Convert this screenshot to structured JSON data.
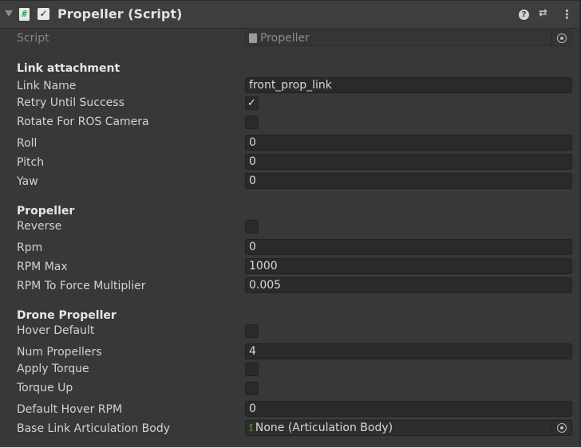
{
  "header": {
    "title": "Propeller (Script)",
    "enabled": true,
    "icons": [
      "foldout-arrow-icon",
      "script-icon",
      "help-icon",
      "preset-icon",
      "kebab-menu-icon"
    ]
  },
  "script_field": {
    "label": "Script",
    "value": "Propeller"
  },
  "link_attachment": {
    "heading": "Link attachment",
    "link_name": {
      "label": "Link Name",
      "value": "front_prop_link"
    },
    "retry_until_success": {
      "label": "Retry Until Success",
      "checked": true
    },
    "rotate_for_ros_camera": {
      "label": "Rotate For ROS Camera",
      "checked": false
    },
    "roll": {
      "label": "Roll",
      "value": "0"
    },
    "pitch": {
      "label": "Pitch",
      "value": "0"
    },
    "yaw": {
      "label": "Yaw",
      "value": "0"
    }
  },
  "propeller": {
    "heading": "Propeller",
    "reverse": {
      "label": "Reverse",
      "checked": false
    },
    "rpm": {
      "label": "Rpm",
      "value": "0"
    },
    "rpm_max": {
      "label": "RPM Max",
      "value": "1000"
    },
    "rpm_to_force_multiplier": {
      "label": "RPM To Force Multiplier",
      "value": "0.005"
    }
  },
  "drone_propeller": {
    "heading": "Drone Propeller",
    "hover_default": {
      "label": "Hover Default",
      "checked": false
    },
    "num_propellers": {
      "label": "Num Propellers",
      "value": "4"
    },
    "apply_torque": {
      "label": "Apply Torque",
      "checked": false
    },
    "torque_up": {
      "label": "Torque Up",
      "checked": false
    },
    "default_hover_rpm": {
      "label": "Default Hover RPM",
      "value": "0"
    },
    "base_link_articulation_body": {
      "label": "Base Link Articulation Body",
      "value": "None (Articulation Body)"
    }
  },
  "check_glyph": "✓"
}
